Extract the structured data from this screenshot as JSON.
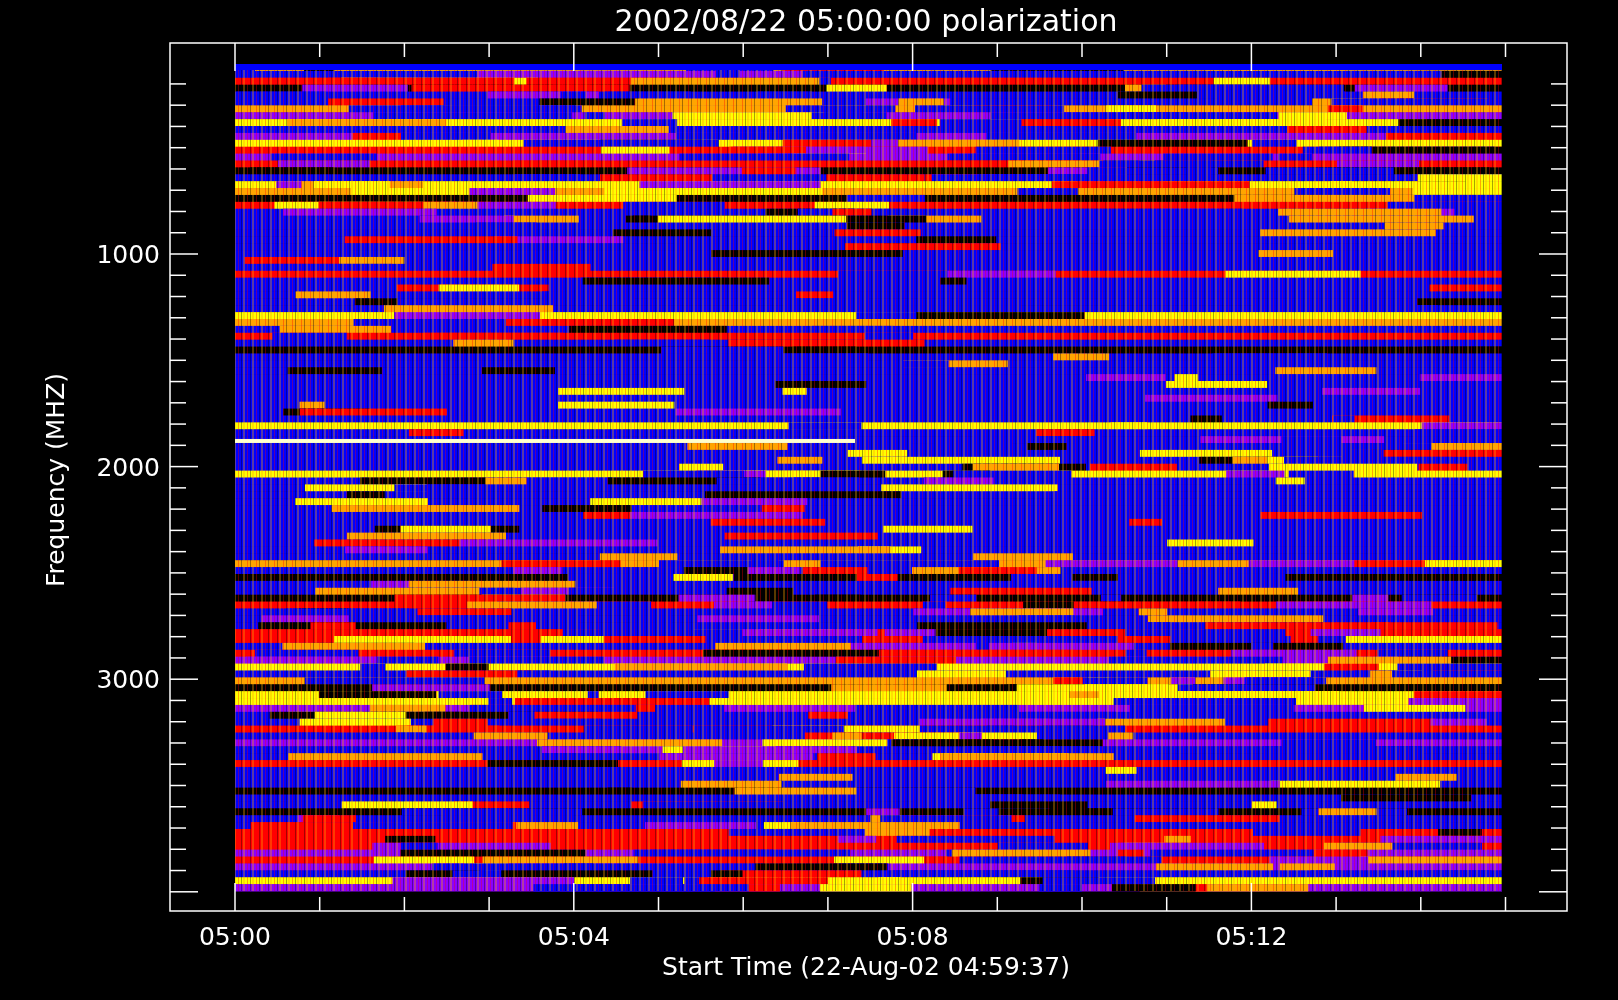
{
  "title": "2002/08/22 05:00:00 polarization",
  "y_axis": {
    "label": "Frequency (MHZ)",
    "ticks": [
      "1000",
      "2000",
      "3000"
    ]
  },
  "x_axis": {
    "label": "Start Time (22-Aug-02 04:59:37)",
    "ticks": [
      "05:00",
      "05:04",
      "05:08",
      "05:12"
    ]
  }
}
